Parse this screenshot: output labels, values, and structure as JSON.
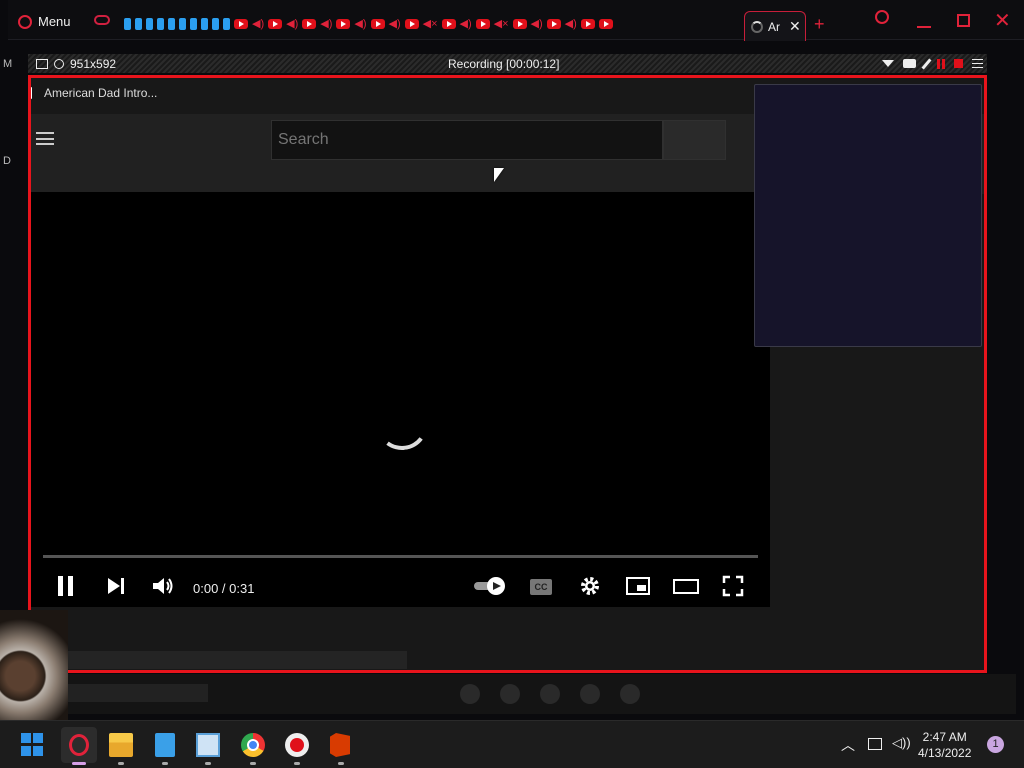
{
  "browser": {
    "menu_label": "Menu",
    "active_tab_label": "Ar",
    "new_tab_symbol": "+"
  },
  "recorder": {
    "size_label": "951x592",
    "status": "Recording [00:00:12]"
  },
  "page": {
    "tab_title": "American Dad Intro...",
    "search_placeholder": "Search"
  },
  "player": {
    "time": "0:00 / 0:31",
    "state": "loading",
    "progress_fraction": 0.0,
    "cc_label": "CC"
  },
  "taskbar": {
    "time": "2:47 AM",
    "date": "4/13/2022",
    "notification_count": "1"
  },
  "colors": {
    "accent": "#e0223a",
    "capture_border": "#e8141c",
    "start_blue": "#2e93ea"
  },
  "left_edge": {
    "letter_m": "M",
    "letter_d": "D"
  }
}
